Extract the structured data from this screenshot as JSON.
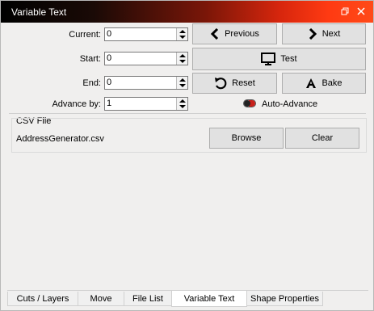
{
  "window": {
    "title": "Variable Text"
  },
  "fields": [
    {
      "label": "Current:",
      "value": "0"
    },
    {
      "label": "Start:",
      "value": "0"
    },
    {
      "label": "End:",
      "value": "0"
    },
    {
      "label": "Advance by:",
      "value": "1"
    }
  ],
  "buttons": {
    "previous": "Previous",
    "next": "Next",
    "test": "Test",
    "reset": "Reset",
    "bake": "Bake",
    "browse": "Browse",
    "clear": "Clear"
  },
  "auto_advance": {
    "label": "Auto-Advance",
    "enabled": false
  },
  "csv": {
    "group_label": "CSV File",
    "filename": "AddressGenerator.csv"
  },
  "tabs": [
    {
      "label": "Cuts / Layers",
      "active": false
    },
    {
      "label": "Move",
      "active": false
    },
    {
      "label": "File List",
      "active": false
    },
    {
      "label": "Variable Text",
      "active": true
    },
    {
      "label": "Shape Properties",
      "active": false
    }
  ],
  "colors": {
    "title_gradient_end": "#ff4a18",
    "toggle_on": "#c8201a"
  }
}
